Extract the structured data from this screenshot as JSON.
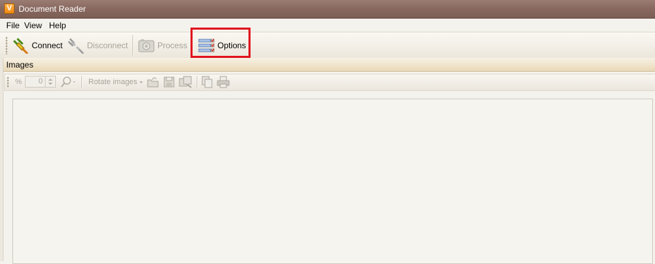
{
  "window": {
    "title": "Document Reader",
    "app_icon_glyph": "V"
  },
  "menu": {
    "items": [
      "File",
      "View",
      "Help"
    ]
  },
  "toolbar": {
    "connect_label": "Connect",
    "disconnect_label": "Disconnect",
    "process_label": "Process",
    "options_label": "Options",
    "highlight_color": "#e0141e"
  },
  "images_panel": {
    "title": "Images",
    "percent_symbol": "%",
    "zoom_value": "0",
    "rotate_label": "Rotate images"
  }
}
